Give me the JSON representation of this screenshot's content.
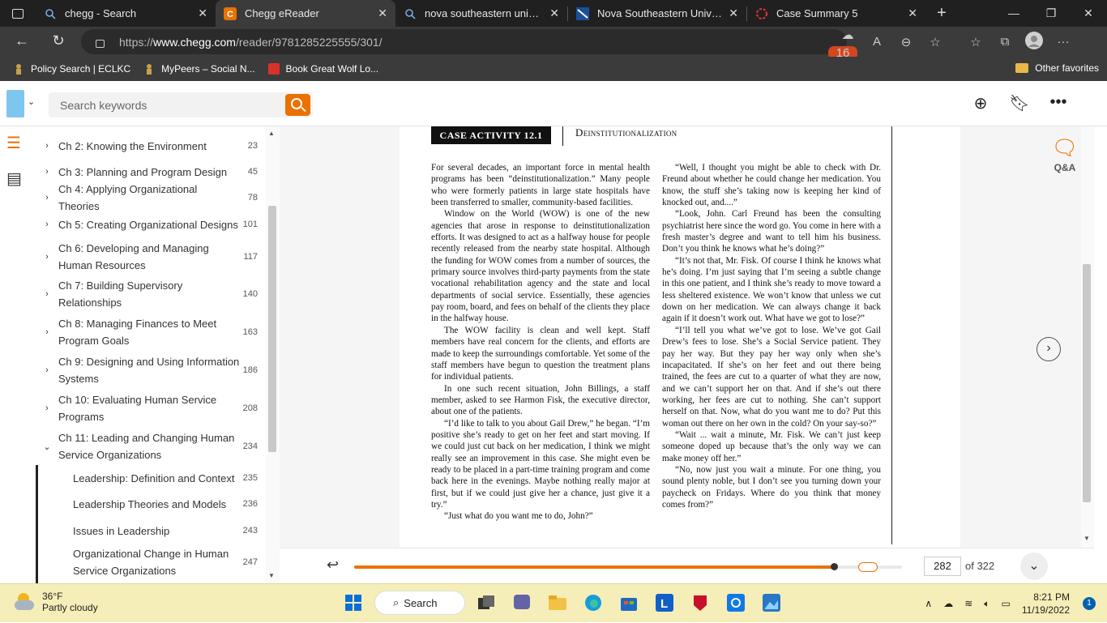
{
  "browser": {
    "tabs": [
      {
        "title": "chegg - Search",
        "icon": "search-icon"
      },
      {
        "title": "Chegg eReader",
        "icon": "chegg-icon",
        "active": true
      },
      {
        "title": "nova southeastern university",
        "icon": "search-icon"
      },
      {
        "title": "Nova Southeastern University",
        "icon": "nsu-icon"
      },
      {
        "title": "Case Summary 5",
        "icon": "loading-icon"
      }
    ],
    "url_prefix": "https://",
    "url_host": "www.chegg.com",
    "url_path": "/reader/9781285225555/301/",
    "extension_badge": "16",
    "bookmarks": [
      "Policy Search | ECLKC",
      "MyPeers – Social N...",
      "Book Great Wolf Lo..."
    ],
    "other_favorites": "Other favorites"
  },
  "reader": {
    "search_placeholder": "Search keywords",
    "toc": [
      {
        "label": "Ch 2: Knowing the Environment",
        "page": "23",
        "expanded": false
      },
      {
        "label": "Ch 3: Planning and Program Design",
        "page": "45",
        "expanded": false
      },
      {
        "label": "Ch 4: Applying Organizational Theories",
        "page": "78",
        "expanded": false
      },
      {
        "label": "Ch 5: Creating Organizational Designs",
        "page": "101",
        "expanded": false
      },
      {
        "label": "Ch 6: Developing and Managing Human Resources",
        "page": "117",
        "expanded": false
      },
      {
        "label": "Ch 7: Building Supervisory Relationships",
        "page": "140",
        "expanded": false
      },
      {
        "label": "Ch 8: Managing Finances to Meet Program Goals",
        "page": "163",
        "expanded": false
      },
      {
        "label": "Ch 9: Designing and Using Information Systems",
        "page": "186",
        "expanded": false
      },
      {
        "label": "Ch 10: Evaluating Human Service Programs",
        "page": "208",
        "expanded": false
      },
      {
        "label": "Ch 11: Leading and Changing Human Service Organizations",
        "page": "234",
        "expanded": true
      }
    ],
    "toc_sub": [
      {
        "label": "Leadership: Definition and Context",
        "page": "235"
      },
      {
        "label": "Leadership Theories and Models",
        "page": "236"
      },
      {
        "label": "Issues in Leadership",
        "page": "243"
      },
      {
        "label": "Organizational Change in Human Service Organizations",
        "page": "247"
      }
    ],
    "case_label": "CASE ACTIVITY 12.1",
    "case_title": "Deinstitutionalization",
    "left_column": [
      "For several decades, an important force in mental health programs has been “deinstitutionalization.” Many people who were formerly patients in large state hospitals have been transferred to smaller, community-based facilities.",
      "Window on the World (WOW) is one of the new agencies that arose in response to deinstitutionalization efforts. It was designed to act as a halfway house for people recently released from the nearby state hospital. Although the funding for WOW comes from a number of sources, the primary source involves third-party payments from the state vocational rehabilitation agency and the state and local departments of social service. Essentially, these agencies pay room, board, and fees on behalf of the clients they place in the halfway house.",
      "The WOW facility is clean and well kept. Staff members have real concern for the clients, and efforts are made to keep the surroundings comfortable. Yet some of the staff members have begun to question the treatment plans for individual patients.",
      "In one such recent situation, John Billings, a staff member, asked to see Harmon Fisk, the executive director, about one of the patients.",
      "“I’d like to talk to you about Gail Drew,” he began. “I’m positive she’s ready to get on her feet and start moving. If we could just cut back on her medication, I think we might really see an improvement in this case. She might even be ready to be placed in a part-time training program and come back here in the evenings. Maybe nothing really major at first, but if we could just give her a chance, just give it a try.”",
      "“Just what do you want me to do, John?”"
    ],
    "right_column": [
      "“Well, I thought you might be able to check with Dr. Freund about whether he could change her medication. You know, the stuff she’s taking now is keeping her kind of knocked out, and....”",
      "“Look, John. Carl Freund has been the consulting psychiatrist here since the word go. You come in here with a fresh master’s degree and want to tell him his business. Don’t you think he knows what he’s doing?”",
      "“It’s not that, Mr. Fisk. Of course I think he knows what he’s doing. I’m just saying that I’m seeing a subtle change in this one patient, and I think she’s ready to move toward a less sheltered existence. We won’t know that unless we cut down on her medication. We can always change it back again if it doesn’t work out. What have we got to lose?”",
      "“I’ll tell you what we’ve got to lose. We’ve got Gail Drew’s fees to lose. She’s a Social Service patient. They pay her way. But they pay her way only when she’s incapacitated. If she’s on her feet and out there being trained, the fees are cut to a quarter of what they are now, and we can’t support her on that. And if she’s out there working, her fees are cut to nothing. She can’t support herself on that. Now, what do you want me to do? Put this woman out there on her own in the cold? On your say-so?”",
      "“Wait ... wait a minute, Mr. Fisk. We can’t just keep someone doped up because that’s the only way we can make money off her.”",
      "“No, now just you wait a minute. For one thing, you sound plenty noble, but I don’t see you turning down your paycheck on Fridays. Where do you think that money comes from?”"
    ],
    "qa_label": "Q&A",
    "current_page": "282",
    "total_pages": "of 322",
    "progress": 0.876
  },
  "taskbar": {
    "temperature": "36°F",
    "weather": "Partly cloudy",
    "search_label": "Search",
    "time": "8:21 PM",
    "date": "11/19/2022",
    "notifications": "1"
  }
}
